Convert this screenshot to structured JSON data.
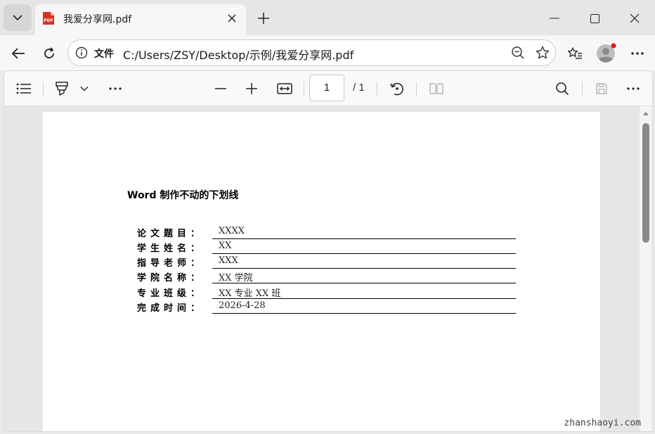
{
  "browser": {
    "tab": {
      "title": "我爱分享网.pdf",
      "favicon": "pdf-icon"
    },
    "address": {
      "label": "文件",
      "url": "C:/Users/ZSY/Desktop/示例/我爱分享网.pdf"
    }
  },
  "pdf_toolbar": {
    "page_current": "1",
    "page_total": "/ 1"
  },
  "document": {
    "title": "Word 制作不动的下划线",
    "fields": [
      {
        "label": "论文题目：",
        "value": "XXXX"
      },
      {
        "label": "学生姓名：",
        "value": "XX"
      },
      {
        "label": "指导老师：",
        "value": "XXX"
      },
      {
        "label": "学院名称：",
        "value": "XX 学院"
      },
      {
        "label": "专业班级：",
        "value": "XX 专业 XX 班"
      },
      {
        "label": "完成时间：",
        "value": "2026-4-28"
      }
    ]
  },
  "watermark": "zhanshaoyi.com",
  "colors": {
    "pdf_favicon": "#d93025",
    "profile_dot": "#e81123"
  }
}
